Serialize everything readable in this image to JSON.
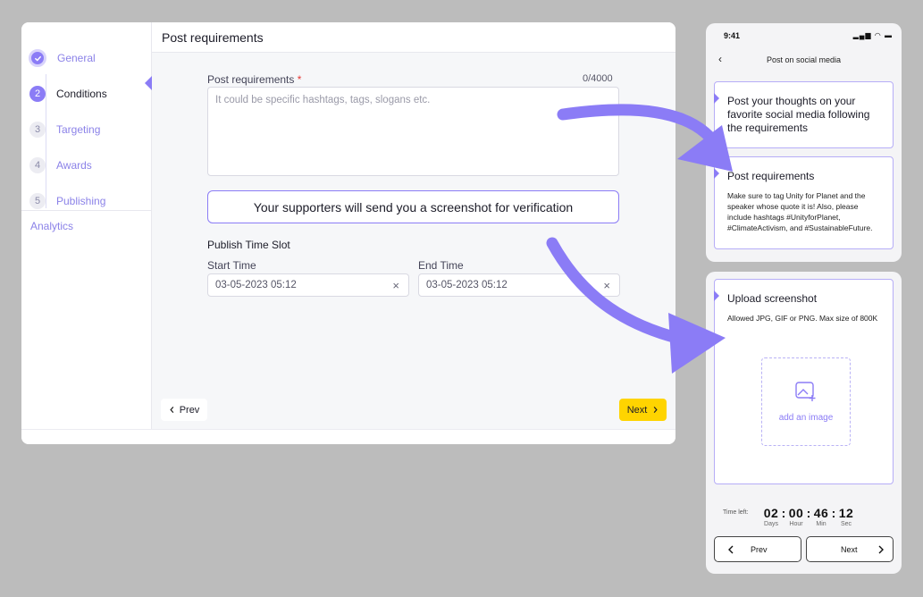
{
  "desktop": {
    "header_title": "Post requirements",
    "steps": [
      {
        "num": "",
        "label": "General",
        "state": "done"
      },
      {
        "num": "2",
        "label": "Conditions",
        "state": "active"
      },
      {
        "num": "3",
        "label": "Targeting",
        "state": "pending"
      },
      {
        "num": "4",
        "label": "Awards",
        "state": "pending"
      },
      {
        "num": "5",
        "label": "Publishing",
        "state": "pending"
      }
    ],
    "analytics_label": "Analytics",
    "post_requirements": {
      "label": "Post requirements",
      "required_mark": "*",
      "counter": "0/4000",
      "placeholder": "It could be specific hashtags, tags, slogans etc."
    },
    "verification_notice": "Your supporters will send you a screenshot for verification",
    "time_slot": {
      "title": "Publish Time Slot",
      "start_label": "Start Time",
      "start_value": "03-05-2023 05:12",
      "end_label": "End Time",
      "end_value": "03-05-2023 05:12",
      "clear_icon": "×"
    },
    "prev_label": "Prev",
    "next_label": "Next",
    "accent": "#8b7cf6",
    "next_color": "#ffd400"
  },
  "phone1": {
    "time": "9:41",
    "status_icons": "▂▄▆ ◠ ▬",
    "back_icon": "‹",
    "title": "Post on social media",
    "card1_text": "Post your thoughts on your favorite social media following the requirements",
    "card2_title": "Post requirements",
    "card2_body": "Make sure to tag Unity for Planet and the speaker whose quote it is! Also, please include hashtags #UnityforPlanet, #ClimateActivism, and #SustainableFuture."
  },
  "phone2": {
    "upload_title": "Upload screenshot",
    "upload_note": "Allowed JPG, GIF or PNG. Max size of 800K",
    "add_image_label": "add an image",
    "time_left_label": "Time left:",
    "timer": [
      {
        "value": "02",
        "caption": "Days"
      },
      {
        "value": "00",
        "caption": "Hour"
      },
      {
        "value": "46",
        "caption": "Min"
      },
      {
        "value": "12",
        "caption": "Sec"
      }
    ],
    "timer_sep": ":",
    "prev_label": "Prev",
    "next_label": "Next"
  }
}
